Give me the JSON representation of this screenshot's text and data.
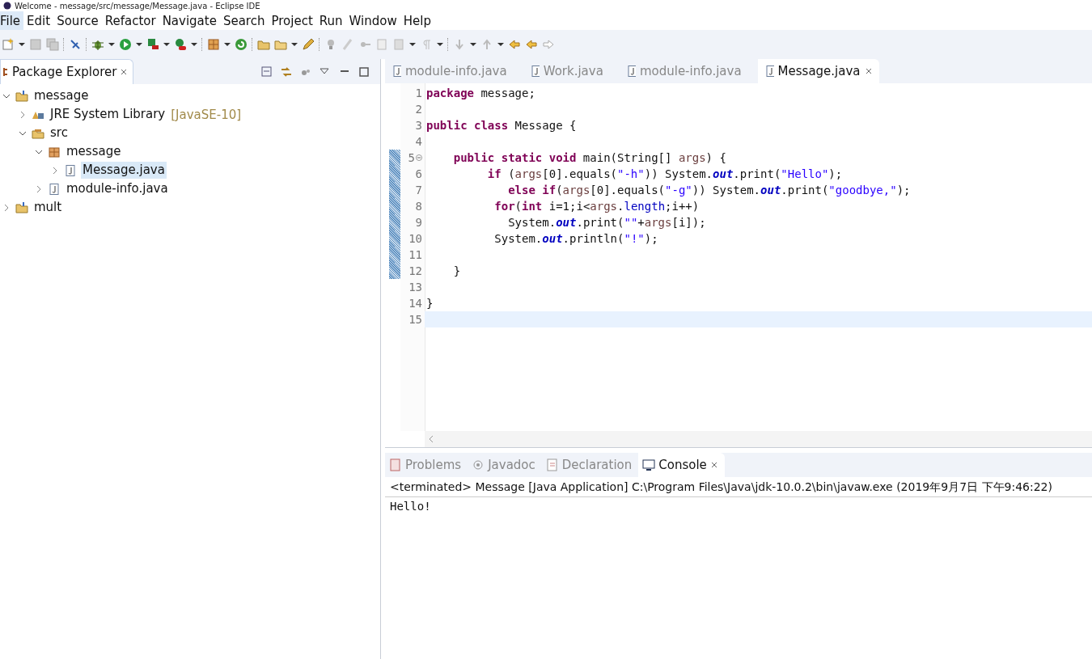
{
  "window": {
    "title": "Welcome - message/src/message/Message.java - Eclipse IDE"
  },
  "menu": [
    {
      "label": "File",
      "selected": true
    },
    {
      "label": "Edit",
      "selected": false
    },
    {
      "label": "Source",
      "selected": false
    },
    {
      "label": "Refactor",
      "selected": false
    },
    {
      "label": "Navigate",
      "selected": false
    },
    {
      "label": "Search",
      "selected": false
    },
    {
      "label": "Project",
      "selected": false
    },
    {
      "label": "Run",
      "selected": false
    },
    {
      "label": "Window",
      "selected": false
    },
    {
      "label": "Help",
      "selected": false
    }
  ],
  "package_explorer": {
    "title": "Package Explorer",
    "tree": [
      {
        "label": "message",
        "kind": "project",
        "expanded": true,
        "selected": false,
        "children": [
          {
            "label": "JRE System Library",
            "suffix": "[JavaSE-10]",
            "kind": "library",
            "expanded": false,
            "selected": false
          },
          {
            "label": "src",
            "kind": "source",
            "expanded": true,
            "selected": false,
            "children": [
              {
                "label": "message",
                "kind": "package",
                "expanded": true,
                "selected": false,
                "children": [
                  {
                    "label": "Message.java",
                    "kind": "file",
                    "expanded": false,
                    "selected": true
                  }
                ]
              },
              {
                "label": "module-info.java",
                "kind": "file",
                "expanded": false,
                "selected": false
              }
            ]
          }
        ]
      },
      {
        "label": "mult",
        "kind": "project",
        "expanded": false,
        "selected": false
      }
    ]
  },
  "editor": {
    "tabs": [
      {
        "label": "module-info.java",
        "selected": false
      },
      {
        "label": "Work.java",
        "selected": false
      },
      {
        "label": "module-info.java",
        "selected": false
      },
      {
        "label": "Message.java",
        "selected": true
      }
    ],
    "lines": [
      {
        "number": "1",
        "changed": false,
        "current": false,
        "tokens": [
          {
            "kind": "keyword",
            "text": "package"
          },
          {
            "kind": "plain",
            "text": " message;"
          }
        ]
      },
      {
        "number": "2",
        "changed": false,
        "current": false
      },
      {
        "number": "3",
        "changed": false,
        "current": false,
        "tokens": [
          {
            "kind": "keyword",
            "text": "public class"
          },
          {
            "kind": "plain",
            "text": " Message {"
          }
        ]
      },
      {
        "number": "4",
        "changed": false,
        "current": false
      },
      {
        "number": "5",
        "changed": true,
        "current": false,
        "fold": true,
        "tokens": [
          {
            "kind": "keyword",
            "text": "    public static void"
          },
          {
            "kind": "plain",
            "text": " main(String[] "
          },
          {
            "kind": "param",
            "text": "args"
          },
          {
            "kind": "plain",
            "text": ") {"
          }
        ]
      },
      {
        "number": "6",
        "changed": true,
        "current": false,
        "tokens": [
          {
            "kind": "keyword",
            "text": "         if"
          },
          {
            "kind": "plain",
            "text": " ("
          },
          {
            "kind": "param",
            "text": "args"
          },
          {
            "kind": "plain",
            "text": "[0].equals("
          },
          {
            "kind": "string",
            "text": "\"-h\""
          },
          {
            "kind": "plain",
            "text": ")) System."
          },
          {
            "kind": "field",
            "text": "out"
          },
          {
            "kind": "plain",
            "text": ".print("
          },
          {
            "kind": "string",
            "text": "\"Hello\""
          },
          {
            "kind": "plain",
            "text": ");"
          }
        ]
      },
      {
        "number": "7",
        "changed": true,
        "current": false,
        "tokens": [
          {
            "kind": "keyword",
            "text": "            else if"
          },
          {
            "kind": "plain",
            "text": "("
          },
          {
            "kind": "param",
            "text": "args"
          },
          {
            "kind": "plain",
            "text": "[0].equals("
          },
          {
            "kind": "string",
            "text": "\"-g\""
          },
          {
            "kind": "plain",
            "text": ")) System."
          },
          {
            "kind": "field",
            "text": "out"
          },
          {
            "kind": "plain",
            "text": ".print("
          },
          {
            "kind": "string",
            "text": "\"goodbye,\""
          },
          {
            "kind": "plain",
            "text": ");"
          }
        ]
      },
      {
        "number": "8",
        "changed": true,
        "current": false,
        "tokens": [
          {
            "kind": "keyword",
            "text": "          for"
          },
          {
            "kind": "plain",
            "text": "("
          },
          {
            "kind": "keyword",
            "text": "int"
          },
          {
            "kind": "plain",
            "text": " i=1;i<"
          },
          {
            "kind": "param",
            "text": "args"
          },
          {
            "kind": "plain",
            "text": "."
          },
          {
            "kind": "member",
            "text": "length"
          },
          {
            "kind": "plain",
            "text": ";i++)"
          }
        ]
      },
      {
        "number": "9",
        "changed": true,
        "current": false,
        "tokens": [
          {
            "kind": "plain",
            "text": "            System."
          },
          {
            "kind": "field",
            "text": "out"
          },
          {
            "kind": "plain",
            "text": ".print("
          },
          {
            "kind": "string",
            "text": "\"\""
          },
          {
            "kind": "plain",
            "text": "+"
          },
          {
            "kind": "param",
            "text": "args"
          },
          {
            "kind": "plain",
            "text": "[i]);"
          }
        ]
      },
      {
        "number": "10",
        "changed": true,
        "current": false,
        "tokens": [
          {
            "kind": "plain",
            "text": "          System."
          },
          {
            "kind": "field",
            "text": "out"
          },
          {
            "kind": "plain",
            "text": ".println("
          },
          {
            "kind": "string",
            "text": "\"!\""
          },
          {
            "kind": "plain",
            "text": ");"
          }
        ]
      },
      {
        "number": "11",
        "changed": true,
        "current": false
      },
      {
        "number": "12",
        "changed": true,
        "current": false,
        "tokens": [
          {
            "kind": "plain",
            "text": "    }"
          }
        ]
      },
      {
        "number": "13",
        "changed": false,
        "current": false
      },
      {
        "number": "14",
        "changed": false,
        "current": false,
        "tokens": [
          {
            "kind": "plain",
            "text": "}"
          }
        ]
      },
      {
        "number": "15",
        "changed": false,
        "current": true
      }
    ]
  },
  "bottom_panel": {
    "tabs": [
      {
        "label": "Problems",
        "selected": false,
        "kind": "problems"
      },
      {
        "label": "Javadoc",
        "selected": false,
        "kind": "javadoc"
      },
      {
        "label": "Declaration",
        "selected": false,
        "kind": "declaration"
      },
      {
        "label": "Console",
        "selected": true,
        "kind": "console"
      }
    ],
    "console_header": "<terminated> Message [Java Application] C:\\Program Files\\Java\\jdk-10.0.2\\bin\\javaw.exe (2019年9月7日 下午9:46:22)",
    "output": "Hello!"
  }
}
